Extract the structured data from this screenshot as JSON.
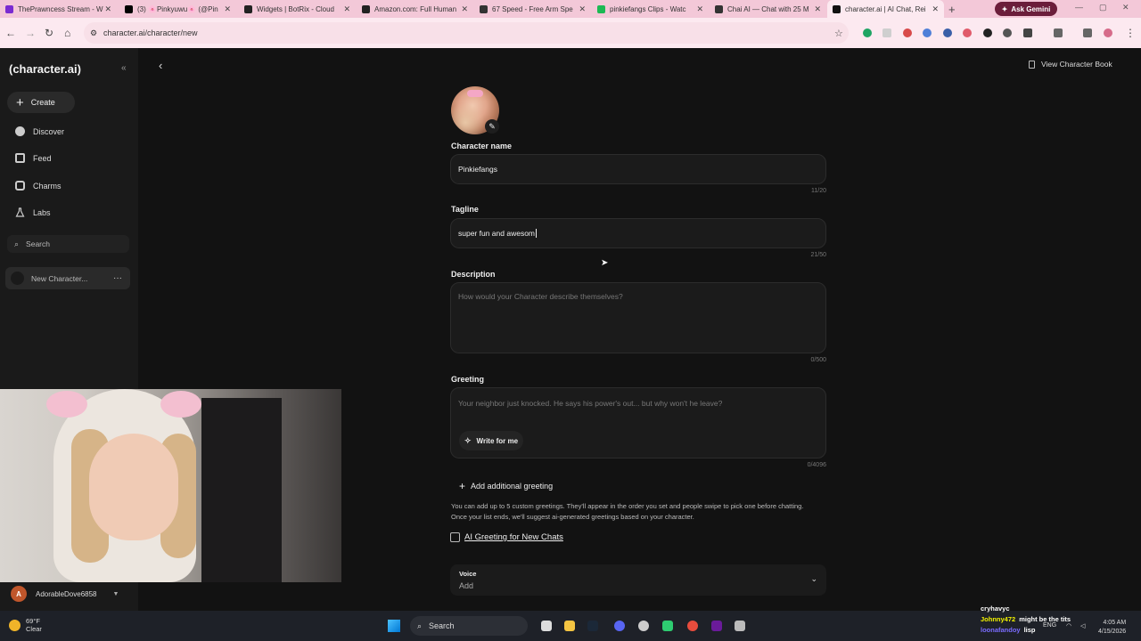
{
  "browser": {
    "tabs": [
      {
        "title": "ThePrawncess Stream - W",
        "color": "#7a2bd1",
        "active": false
      },
      {
        "title": "(3) 🌸Pinkyuwu🌸 (@Pin",
        "color": "#000000",
        "active": false
      },
      {
        "title": "Widgets | BotRix - Cloud",
        "color": "#222222",
        "active": false
      },
      {
        "title": "Amazon.com: Full Human",
        "color": "#222222",
        "active": false
      },
      {
        "title": "67 Speed - Free Arm Spe",
        "color": "#333333",
        "active": false
      },
      {
        "title": "pinkiefangs Clips - Watc",
        "color": "#1db954",
        "active": false
      },
      {
        "title": "Chai AI — Chat with 25 M",
        "color": "#333333",
        "active": false
      },
      {
        "title": "character.ai | AI Chat, Rei",
        "color": "#111111",
        "active": true
      }
    ],
    "new_tab": "+",
    "gemini_label": "Ask Gemini",
    "url": "character.ai/character/new"
  },
  "sidebar": {
    "logo": "(character.ai)",
    "create_label": "Create",
    "items": [
      {
        "label": "Discover",
        "icon": "compass-icon"
      },
      {
        "label": "Feed",
        "icon": "feed-icon"
      },
      {
        "label": "Charms",
        "icon": "charms-icon"
      },
      {
        "label": "Labs",
        "icon": "flask-icon"
      }
    ],
    "search_placeholder": "Search",
    "recent_item": "New Character...",
    "recent_more": "···",
    "user": {
      "initial": "A",
      "name": "AdorableDove6858"
    }
  },
  "header": {
    "view_book": "View Character Book"
  },
  "form": {
    "name_label": "Character name",
    "name_value": "Pinkiefangs",
    "name_counter": "11/20",
    "tagline_label": "Tagline",
    "tagline_value": "super fun and awesom",
    "tagline_counter": "21/50",
    "description_label": "Description",
    "description_placeholder": "How would your Character describe themselves?",
    "description_counter": "0/500",
    "greeting_label": "Greeting",
    "greeting_placeholder": "Your neighbor just knocked. He says his power's out... but why won't he leave?",
    "write_for_me": "Write for me",
    "greeting_counter": "0/4096",
    "add_greeting": "Add additional greeting",
    "helper_text": "You can add up to 5 custom greetings. They'll appear in the order you set and people swipe to pick one before chatting. Once your list ends, we'll suggest ai-generated greetings based on your character.",
    "ai_greeting_label": "AI Greeting for New Chats",
    "voice_label": "Voice",
    "voice_value": "Add"
  },
  "taskbar": {
    "weather_temp": "69°F",
    "weather_desc": "Clear",
    "search_label": "Search",
    "chat_lines": [
      {
        "user": "cryhavyc",
        "msg": "",
        "color": "#ffffff"
      },
      {
        "user": "Johnny472",
        "msg": "might be the tits",
        "color": "#f2f200"
      },
      {
        "user": "loonafandoy",
        "msg": "lisp",
        "color": "#7a6cff"
      }
    ],
    "lang": "ENG",
    "time": "4:05 AM",
    "date": "4/15/2026"
  }
}
